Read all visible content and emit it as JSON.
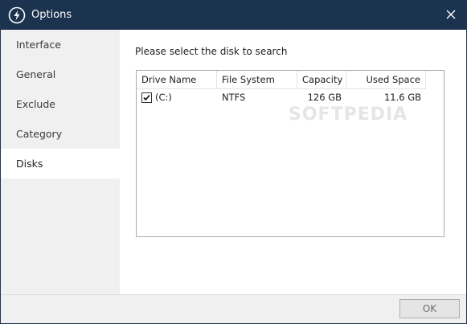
{
  "window": {
    "title": "Options"
  },
  "sidebar": {
    "items": [
      {
        "label": "Interface"
      },
      {
        "label": "General"
      },
      {
        "label": "Exclude"
      },
      {
        "label": "Category"
      },
      {
        "label": "Disks",
        "active": true
      }
    ]
  },
  "main": {
    "prompt": "Please select the disk to search",
    "columns": [
      "Drive Name",
      "File System",
      "Capacity",
      "Used Space"
    ],
    "rows": [
      {
        "checked": true,
        "drive": "(C:)",
        "file_system": "NTFS",
        "capacity": "126 GB",
        "used": "11.6 GB"
      }
    ],
    "watermark": "SOFTPEDIA"
  },
  "footer": {
    "ok_label": "OK"
  },
  "colors": {
    "titlebar": "#1c3350",
    "sidebar_bg": "#f0f0f0",
    "active_bg": "#ffffff",
    "border": "#a9a9a9"
  },
  "icons": {
    "app": "lightning-bolt-icon",
    "close": "close-icon",
    "check": "checkmark-icon"
  }
}
